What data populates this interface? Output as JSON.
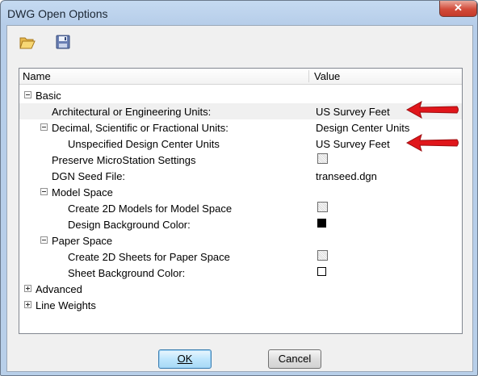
{
  "window": {
    "title": "DWG Open Options",
    "close_label": "✕"
  },
  "toolbar": {
    "open_icon": "folder-open-icon",
    "save_icon": "floppy-disk-icon"
  },
  "grid": {
    "columns": {
      "name": "Name",
      "value": "Value"
    },
    "rows": [
      {
        "label": "Basic",
        "value": ""
      },
      {
        "label": "Architectural or Engineering Units:",
        "value": "US Survey Feet"
      },
      {
        "label": "Decimal, Scientific or Fractional Units:",
        "value": "Design Center Units"
      },
      {
        "label": "Unspecified Design Center Units",
        "value": "US Survey Feet"
      },
      {
        "label": "Preserve MicroStation Settings",
        "value": ""
      },
      {
        "label": "DGN Seed File:",
        "value": "transeed.dgn"
      },
      {
        "label": "Model Space",
        "value": ""
      },
      {
        "label": "Create 2D Models for Model Space",
        "value": ""
      },
      {
        "label": "Design Background Color:",
        "value": ""
      },
      {
        "label": "Paper Space",
        "value": ""
      },
      {
        "label": "Create 2D Sheets for Paper Space",
        "value": ""
      },
      {
        "label": "Sheet Background Color:",
        "value": ""
      },
      {
        "label": "Advanced",
        "value": ""
      },
      {
        "label": "Line Weights",
        "value": ""
      }
    ],
    "colors": {
      "design_background": "#000000",
      "sheet_background": "#ffffff",
      "annotation_arrow": "#e0161b"
    }
  },
  "buttons": {
    "ok": "OK",
    "cancel": "Cancel"
  }
}
